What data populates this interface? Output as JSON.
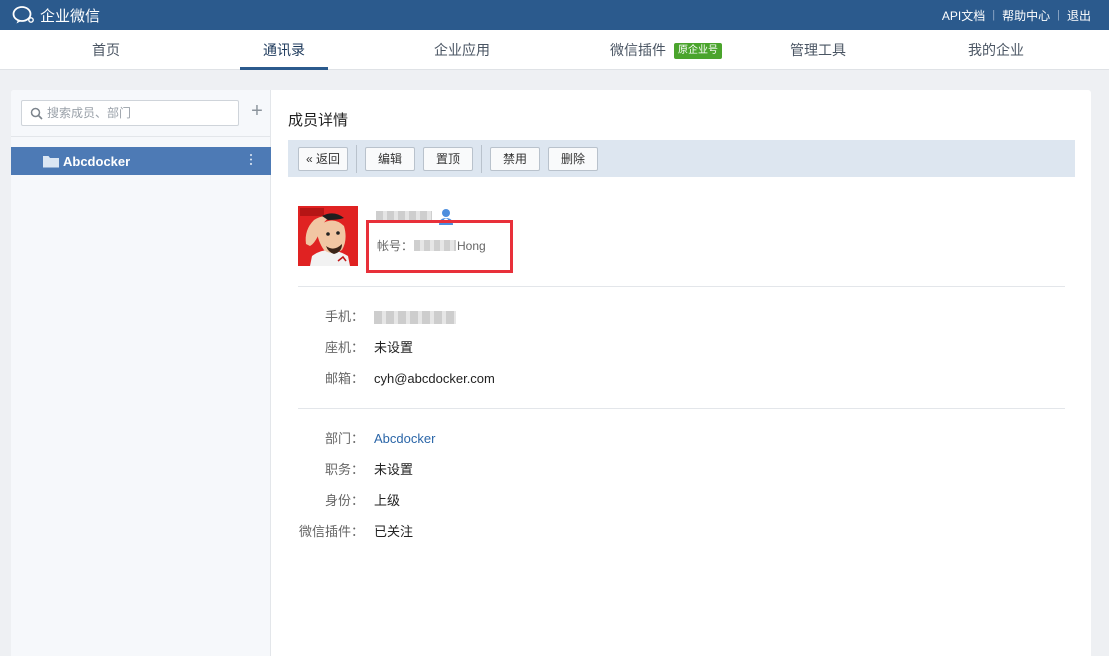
{
  "app": {
    "title": "企业微信"
  },
  "top_links": [
    {
      "label": "API文档"
    },
    {
      "label": "帮助中心"
    },
    {
      "label": "退出"
    }
  ],
  "nav": {
    "items": [
      {
        "label": "首页"
      },
      {
        "label": "通讯录"
      },
      {
        "label": "企业应用"
      },
      {
        "label": "微信插件",
        "badge": "原企业号"
      },
      {
        "label": "管理工具"
      },
      {
        "label": "我的企业"
      }
    ],
    "active": "通讯录"
  },
  "sidebar": {
    "search_placeholder": "搜索成员、部门",
    "department": "Abcdocker"
  },
  "page": {
    "title": "成员详情",
    "toolbar": {
      "back": "« 返回",
      "edit": "编辑",
      "pin": "置顶",
      "disable": "禁用",
      "delete": "删除"
    }
  },
  "member": {
    "account_label": "帐号：",
    "account_suffix": "Hong",
    "contact": {
      "phone_label": "手机：",
      "landline_label": "座机：",
      "landline_value": "未设置",
      "email_label": "邮箱：",
      "email_value": "cyh@abcdocker.com"
    },
    "org": {
      "dept_label": "部门：",
      "dept_value": "Abcdocker",
      "position_label": "职务：",
      "position_value": "未设置",
      "identity_label": "身份：",
      "identity_value": "上级",
      "plugin_label": "微信插件：",
      "plugin_value": "已关注"
    }
  },
  "colors": {
    "topbar": "#2b5a8d",
    "selected_dept": "#4d7ab5",
    "highlight_box": "#e8303a",
    "badge": "#4aa42c",
    "link": "#2b66a8"
  }
}
